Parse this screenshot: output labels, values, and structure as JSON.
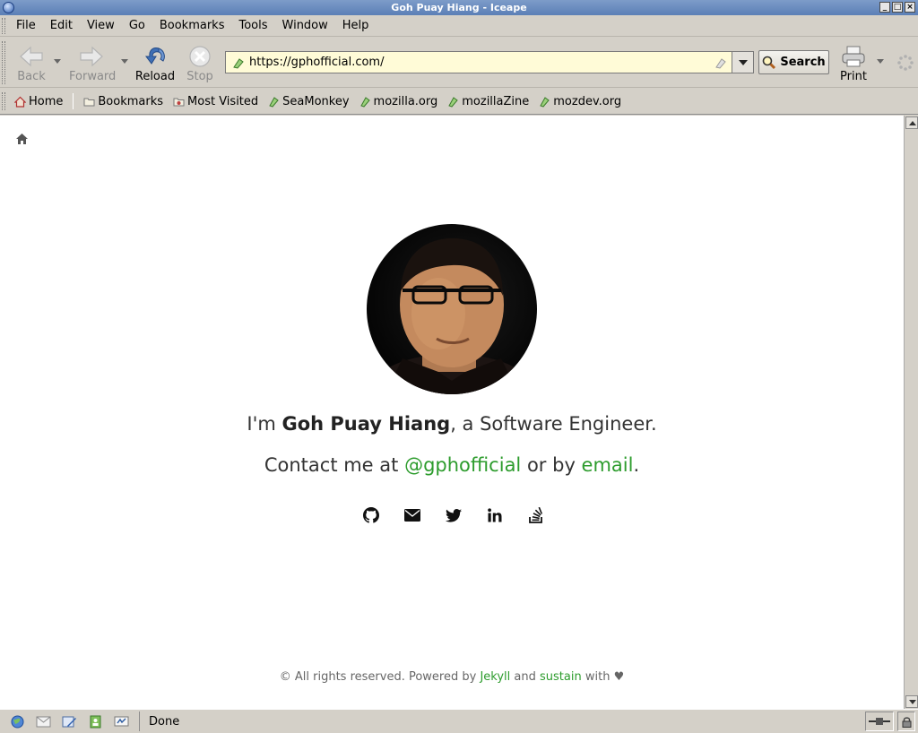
{
  "window": {
    "title": "Goh Puay Hiang - Iceape"
  },
  "menu": [
    "File",
    "Edit",
    "View",
    "Go",
    "Bookmarks",
    "Tools",
    "Window",
    "Help"
  ],
  "toolbar": {
    "back_label": "Back",
    "forward_label": "Forward",
    "reload_label": "Reload",
    "stop_label": "Stop",
    "url": "https://gphofficial.com/",
    "search_label": "Search",
    "print_label": "Print"
  },
  "bookmarks": {
    "home": "Home",
    "items": [
      "Bookmarks",
      "Most Visited",
      "SeaMonkey",
      "mozilla.org",
      "mozillaZine",
      "mozdev.org"
    ]
  },
  "page": {
    "intro_prefix": "I'm ",
    "name": "Goh Puay Hiang",
    "intro_suffix": ", a Software Engineer.",
    "contact_prefix": "Contact me at ",
    "handle": "@gphofficial",
    "contact_mid": " or by ",
    "email_link": "email",
    "contact_end": ".",
    "socials": [
      "github-icon",
      "envelope-icon",
      "twitter-icon",
      "linkedin-icon",
      "stackoverflow-icon"
    ],
    "footer_prefix": "© All rights reserved. Powered by ",
    "footer_jekyll": "Jekyll",
    "footer_and": " and ",
    "footer_sustain": "sustain",
    "footer_with": " with ",
    "footer_heart": "♥"
  },
  "status": {
    "text": "Done"
  },
  "colors": {
    "link": "#2d9c2d",
    "titlebar": "#5b7fb6",
    "urlbar_bg": "#fffbd7"
  }
}
